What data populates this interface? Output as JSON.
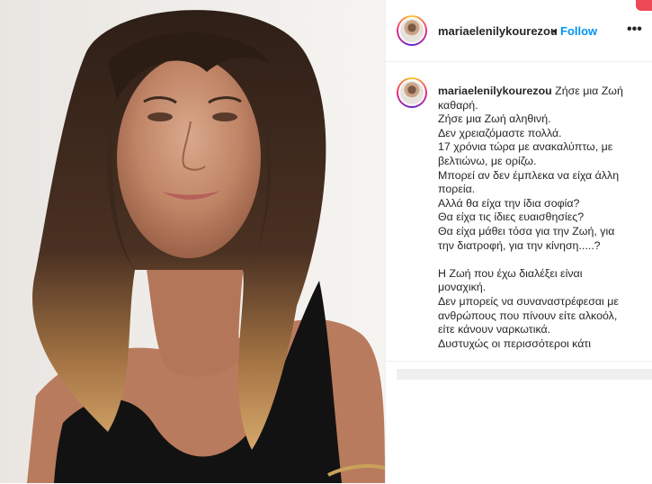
{
  "post": {
    "author": "mariaelenilykourezou",
    "separator": "•",
    "follow_label": "Follow",
    "more_label": "•••"
  },
  "caption": {
    "author": "mariaelenilykourezou",
    "first_line": "Ζήσε μια Ζωή",
    "lines": [
      "καθαρή.",
      "Ζήσε μια Ζωή αληθινή.",
      "Δεν χρειαζόμαστε πολλά.",
      "17 χρόνια τώρα με ανακαλύπτω, με",
      "βελτιώνω, με ορίζω.",
      "Μπορεί αν δεν έμπλεκα να είχα άλλη",
      "πορεία.",
      "Αλλά θα είχα την ίδια σοφία?",
      "Θα είχα τις ίδιες ευαισθησίες?",
      "Θα είχα μάθει τόσα για την Ζωή, για",
      "την διατροφή, για την κίνηση.....?",
      "",
      "Η Ζωή που έχω διαλέξει είναι",
      "μοναχική.",
      "Δεν μπορείς να συναναστρέφεσαι με",
      "ανθρώπους που πίνουν είτε αλκοόλ,",
      "είτε κάνουν ναρκωτικά.",
      "Δυστυχώς οι περισσότεροι κάτι"
    ]
  },
  "icons": {
    "header_avatar": "profile-avatar-icon",
    "caption_avatar": "profile-avatar-icon",
    "more": "more-options-icon"
  },
  "colors": {
    "link_blue": "#0095f6",
    "text": "#262626",
    "divider": "#efefef",
    "notification_red": "#ed4956"
  }
}
